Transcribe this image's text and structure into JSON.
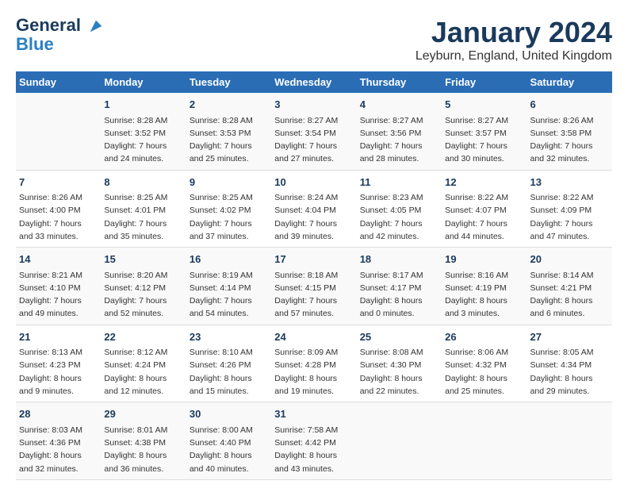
{
  "header": {
    "logo_line1": "General",
    "logo_line2": "Blue",
    "month": "January 2024",
    "location": "Leyburn, England, United Kingdom"
  },
  "days_of_week": [
    "Sunday",
    "Monday",
    "Tuesday",
    "Wednesday",
    "Thursday",
    "Friday",
    "Saturday"
  ],
  "weeks": [
    [
      {
        "day": "",
        "info": ""
      },
      {
        "day": "1",
        "info": "Sunrise: 8:28 AM\nSunset: 3:52 PM\nDaylight: 7 hours\nand 24 minutes."
      },
      {
        "day": "2",
        "info": "Sunrise: 8:28 AM\nSunset: 3:53 PM\nDaylight: 7 hours\nand 25 minutes."
      },
      {
        "day": "3",
        "info": "Sunrise: 8:27 AM\nSunset: 3:54 PM\nDaylight: 7 hours\nand 27 minutes."
      },
      {
        "day": "4",
        "info": "Sunrise: 8:27 AM\nSunset: 3:56 PM\nDaylight: 7 hours\nand 28 minutes."
      },
      {
        "day": "5",
        "info": "Sunrise: 8:27 AM\nSunset: 3:57 PM\nDaylight: 7 hours\nand 30 minutes."
      },
      {
        "day": "6",
        "info": "Sunrise: 8:26 AM\nSunset: 3:58 PM\nDaylight: 7 hours\nand 32 minutes."
      }
    ],
    [
      {
        "day": "7",
        "info": "Sunrise: 8:26 AM\nSunset: 4:00 PM\nDaylight: 7 hours\nand 33 minutes."
      },
      {
        "day": "8",
        "info": "Sunrise: 8:25 AM\nSunset: 4:01 PM\nDaylight: 7 hours\nand 35 minutes."
      },
      {
        "day": "9",
        "info": "Sunrise: 8:25 AM\nSunset: 4:02 PM\nDaylight: 7 hours\nand 37 minutes."
      },
      {
        "day": "10",
        "info": "Sunrise: 8:24 AM\nSunset: 4:04 PM\nDaylight: 7 hours\nand 39 minutes."
      },
      {
        "day": "11",
        "info": "Sunrise: 8:23 AM\nSunset: 4:05 PM\nDaylight: 7 hours\nand 42 minutes."
      },
      {
        "day": "12",
        "info": "Sunrise: 8:22 AM\nSunset: 4:07 PM\nDaylight: 7 hours\nand 44 minutes."
      },
      {
        "day": "13",
        "info": "Sunrise: 8:22 AM\nSunset: 4:09 PM\nDaylight: 7 hours\nand 47 minutes."
      }
    ],
    [
      {
        "day": "14",
        "info": "Sunrise: 8:21 AM\nSunset: 4:10 PM\nDaylight: 7 hours\nand 49 minutes."
      },
      {
        "day": "15",
        "info": "Sunrise: 8:20 AM\nSunset: 4:12 PM\nDaylight: 7 hours\nand 52 minutes."
      },
      {
        "day": "16",
        "info": "Sunrise: 8:19 AM\nSunset: 4:14 PM\nDaylight: 7 hours\nand 54 minutes."
      },
      {
        "day": "17",
        "info": "Sunrise: 8:18 AM\nSunset: 4:15 PM\nDaylight: 7 hours\nand 57 minutes."
      },
      {
        "day": "18",
        "info": "Sunrise: 8:17 AM\nSunset: 4:17 PM\nDaylight: 8 hours\nand 0 minutes."
      },
      {
        "day": "19",
        "info": "Sunrise: 8:16 AM\nSunset: 4:19 PM\nDaylight: 8 hours\nand 3 minutes."
      },
      {
        "day": "20",
        "info": "Sunrise: 8:14 AM\nSunset: 4:21 PM\nDaylight: 8 hours\nand 6 minutes."
      }
    ],
    [
      {
        "day": "21",
        "info": "Sunrise: 8:13 AM\nSunset: 4:23 PM\nDaylight: 8 hours\nand 9 minutes."
      },
      {
        "day": "22",
        "info": "Sunrise: 8:12 AM\nSunset: 4:24 PM\nDaylight: 8 hours\nand 12 minutes."
      },
      {
        "day": "23",
        "info": "Sunrise: 8:10 AM\nSunset: 4:26 PM\nDaylight: 8 hours\nand 15 minutes."
      },
      {
        "day": "24",
        "info": "Sunrise: 8:09 AM\nSunset: 4:28 PM\nDaylight: 8 hours\nand 19 minutes."
      },
      {
        "day": "25",
        "info": "Sunrise: 8:08 AM\nSunset: 4:30 PM\nDaylight: 8 hours\nand 22 minutes."
      },
      {
        "day": "26",
        "info": "Sunrise: 8:06 AM\nSunset: 4:32 PM\nDaylight: 8 hours\nand 25 minutes."
      },
      {
        "day": "27",
        "info": "Sunrise: 8:05 AM\nSunset: 4:34 PM\nDaylight: 8 hours\nand 29 minutes."
      }
    ],
    [
      {
        "day": "28",
        "info": "Sunrise: 8:03 AM\nSunset: 4:36 PM\nDaylight: 8 hours\nand 32 minutes."
      },
      {
        "day": "29",
        "info": "Sunrise: 8:01 AM\nSunset: 4:38 PM\nDaylight: 8 hours\nand 36 minutes."
      },
      {
        "day": "30",
        "info": "Sunrise: 8:00 AM\nSunset: 4:40 PM\nDaylight: 8 hours\nand 40 minutes."
      },
      {
        "day": "31",
        "info": "Sunrise: 7:58 AM\nSunset: 4:42 PM\nDaylight: 8 hours\nand 43 minutes."
      },
      {
        "day": "",
        "info": ""
      },
      {
        "day": "",
        "info": ""
      },
      {
        "day": "",
        "info": ""
      }
    ]
  ]
}
